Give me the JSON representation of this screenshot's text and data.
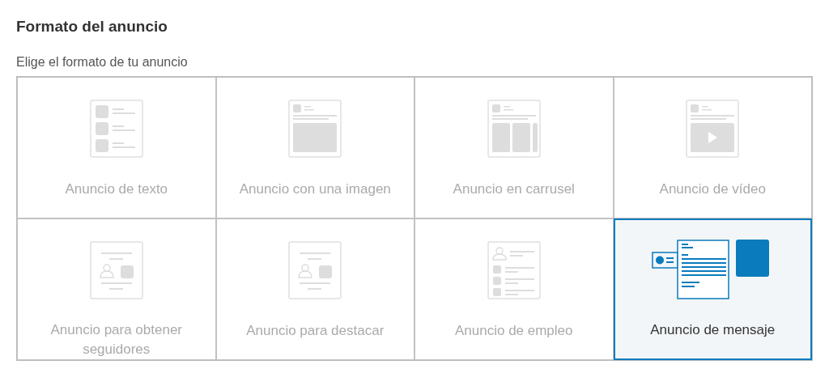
{
  "section": {
    "title": "Formato del anuncio",
    "prompt": "Elige el formato de tu anuncio"
  },
  "formats": [
    {
      "kind": "text",
      "label": "Anuncio de texto",
      "selected": false,
      "disabled": true
    },
    {
      "kind": "image",
      "label": "Anuncio con una imagen",
      "selected": false,
      "disabled": true
    },
    {
      "kind": "carousel",
      "label": "Anuncio en carrusel",
      "selected": false,
      "disabled": true
    },
    {
      "kind": "video",
      "label": "Anuncio de vídeo",
      "selected": false,
      "disabled": true
    },
    {
      "kind": "follower",
      "label": "Anuncio para obtener seguidores",
      "selected": false,
      "disabled": true
    },
    {
      "kind": "spotlight",
      "label": "Anuncio para destacar",
      "selected": false,
      "disabled": true
    },
    {
      "kind": "job",
      "label": "Anuncio de empleo",
      "selected": false,
      "disabled": true
    },
    {
      "kind": "message",
      "label": "Anuncio de mensaje",
      "selected": true,
      "disabled": false
    }
  ]
}
